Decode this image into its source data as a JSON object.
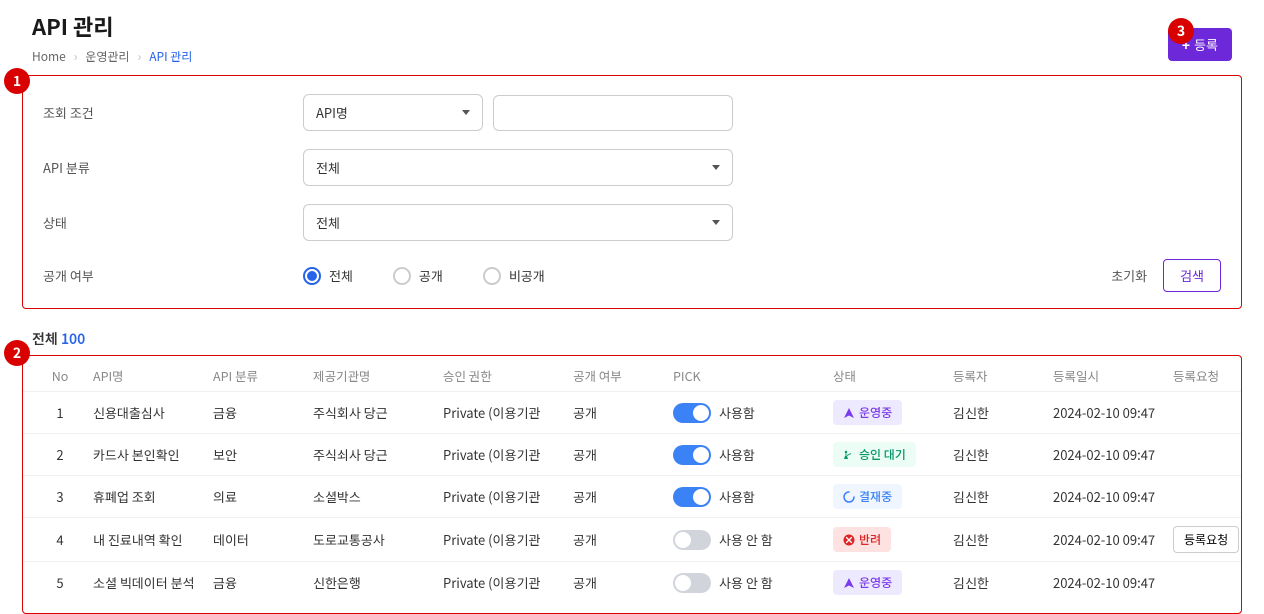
{
  "header": {
    "title": "API 관리",
    "breadcrumb": {
      "home": "Home",
      "level1": "운영관리",
      "current": "API 관리"
    },
    "register_label": "등록"
  },
  "callouts": {
    "c1": "1",
    "c2": "2",
    "c3": "3"
  },
  "search": {
    "labels": {
      "condition": "조회 조건",
      "category": "API 분류",
      "status": "상태",
      "visibility": "공개 여부"
    },
    "condition_select": "API명",
    "category_select": "전체",
    "status_select": "전체",
    "visibility_options": {
      "all": "전체",
      "public": "공개",
      "private": "비공개"
    },
    "reset_label": "초기화",
    "search_label": "검색"
  },
  "total": {
    "label": "전체",
    "count": "100"
  },
  "table": {
    "headers": {
      "no": "No",
      "name": "API명",
      "category": "API 분류",
      "provider": "제공기관명",
      "permission": "승인 권한",
      "visibility": "공개 여부",
      "pick": "PICK",
      "status": "상태",
      "registrant": "등록자",
      "reg_date": "등록일시",
      "reg_request": "등록요청"
    },
    "pick_on_label": "사용함",
    "pick_off_label": "사용 안 함",
    "status_labels": {
      "operating": "운영중",
      "pending": "승인 대기",
      "processing": "결재중",
      "rejected": "반려"
    },
    "request_button_label": "등록요청",
    "rows": [
      {
        "no": "1",
        "name": "신용대출심사",
        "category": "금융",
        "provider": "주식회사 당근",
        "permission": "Private (이용기관",
        "visibility": "공개",
        "pick": true,
        "status": "operating",
        "registrant": "김신한",
        "reg_date": "2024-02-10 09:47"
      },
      {
        "no": "2",
        "name": "카드사 본인확인",
        "category": "보안",
        "provider": "주식쇠사 당근",
        "permission": "Private (이용기관",
        "visibility": "공개",
        "pick": true,
        "status": "pending",
        "registrant": "김신한",
        "reg_date": "2024-02-10 09:47"
      },
      {
        "no": "3",
        "name": "휴폐업 조회",
        "category": "의료",
        "provider": "소셜박스",
        "permission": "Private (이용기관",
        "visibility": "공개",
        "pick": true,
        "status": "processing",
        "registrant": "김신한",
        "reg_date": "2024-02-10 09:47"
      },
      {
        "no": "4",
        "name": "내 진료내역 확인",
        "category": "데이터",
        "provider": "도로교통공사",
        "permission": "Private (이용기관",
        "visibility": "공개",
        "pick": false,
        "status": "rejected",
        "registrant": "김신한",
        "reg_date": "2024-02-10 09:47",
        "request_button": true
      },
      {
        "no": "5",
        "name": "소셜 빅데이터 분석",
        "category": "금융",
        "provider": "신한은행",
        "permission": "Private (이용기관",
        "visibility": "공개",
        "pick": false,
        "status": "operating",
        "registrant": "김신한",
        "reg_date": "2024-02-10 09:47"
      }
    ]
  }
}
